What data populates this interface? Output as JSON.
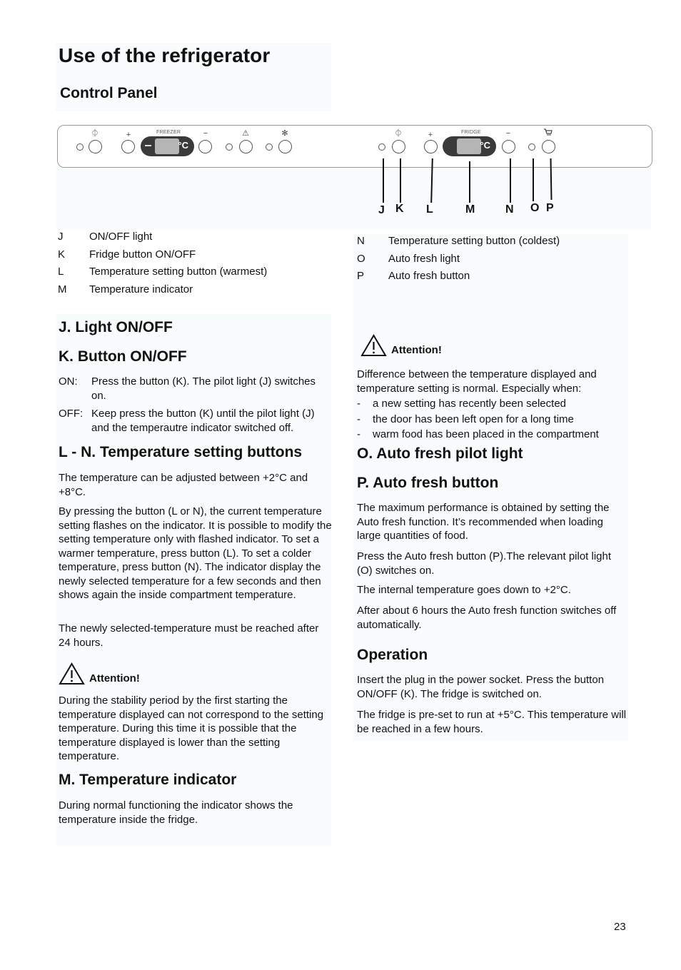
{
  "page": {
    "title": "Use of the refrigerator",
    "subtitle": "Control Panel",
    "page_number": "23"
  },
  "panel": {
    "freezer_label": "FREEZER",
    "fridge_label": "FRIDGE",
    "degree_symbol": "°C",
    "symbols": {
      "power": "⏀",
      "plus": "+",
      "minus": "−",
      "alarm": "⚠",
      "fastfreeze": "✻",
      "cart": "🛒"
    },
    "callouts": [
      "J",
      "K",
      "L",
      "M",
      "N",
      "O",
      "P"
    ]
  },
  "legend_left": [
    {
      "key": "J",
      "text": "ON/OFF light"
    },
    {
      "key": "K",
      "text": "Fridge button ON/OFF"
    },
    {
      "key": "L",
      "text": "Temperature setting button (warmest)"
    },
    {
      "key": "M",
      "text": "Temperature indicator"
    }
  ],
  "legend_right": [
    {
      "key": "N",
      "text": "Temperature setting button (coldest)"
    },
    {
      "key": "O",
      "text": "Auto fresh light"
    },
    {
      "key": "P",
      "text": "Auto fresh button"
    }
  ],
  "left_col": {
    "j_heading": "J. Light ON/OFF",
    "k_heading": "K. Button ON/OFF",
    "k_items": [
      {
        "key": "ON:",
        "text": "Press the button (K). The pilot light (J) switches on."
      },
      {
        "key": "OFF:",
        "text": "Keep press the button (K) until the pilot light (J) and the temperautre indicator switched off."
      }
    ],
    "ln_heading": "L - N. Temperature setting buttons",
    "ln_p1": "The temperature can be adjusted between +2°C and +8°C.",
    "ln_p2": "By pressing the button (L or N), the current temperature setting flashes on the indicator. It is possible to modify the setting temperature only with flashed indicator. To set a warmer temperature, press button (L). To set a colder temperature, press button (N). The indicator display the newly selected temperature for a few seconds and then shows again the inside compartment temperature.",
    "ln_p3": "The newly selected-temperature must be reached after 24 hours.",
    "attention_label": "Attention!",
    "attention_text": "During the stability period by the first starting the temperature displayed can not correspond to the setting temperature. During this time it is possible that the temperature displayed is lower than the setting temperature.",
    "m_heading": "M. Temperature indicator",
    "m_text": "During normal functioning the indicator shows the temperature inside the fridge."
  },
  "right_col": {
    "attention_label": "Attention!",
    "attention_text": "Difference between the temperature displayed and temperature setting is normal. Especially when:",
    "bullets": [
      "a new setting has recently been selected",
      "the door has been left open for a long time",
      "warm food has been placed in the compartment"
    ],
    "o_heading": "O. Auto fresh pilot light",
    "p_heading": "P. Auto fresh button",
    "p_p1": "The maximum performance is obtained by setting the Auto fresh function. It’s recommended when loading large quantities of food.",
    "p_p2": "Press the Auto fresh button (P).The relevant pilot light (O) switches on.",
    "p_p3": "The internal temperature goes down to +2°C.",
    "p_p4": "After about 6 hours the Auto fresh function switches off automatically.",
    "op_heading": "Operation",
    "op_p1": "Insert the plug in the power socket. Press the button ON/OFF (K). The fridge is switched on.",
    "op_p2": "The fridge is pre-set to run at +5°C. This temperature will be reached in a few hours."
  }
}
